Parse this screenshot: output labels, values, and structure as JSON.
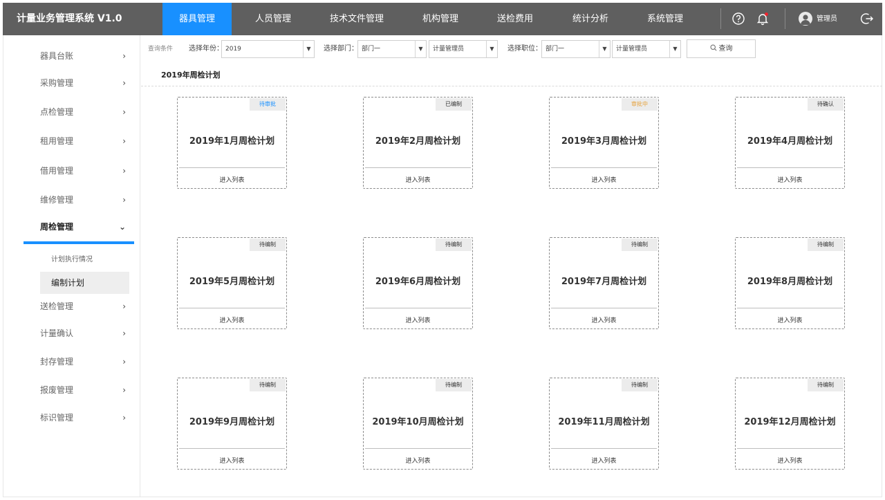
{
  "app": {
    "title": "计量业务管理系统 V1.0"
  },
  "nav": [
    {
      "label": "器具管理",
      "active": true
    },
    {
      "label": "人员管理"
    },
    {
      "label": "技术文件管理"
    },
    {
      "label": "机构管理"
    },
    {
      "label": "送检费用"
    },
    {
      "label": "统计分析"
    },
    {
      "label": "系统管理"
    }
  ],
  "user": {
    "name": "管理员"
  },
  "icons": {
    "help": "help-circle-icon",
    "bell": "bell-icon",
    "logout": "logout-icon",
    "avatar": "user-avatar-icon"
  },
  "colors": {
    "accent": "#1890ff",
    "topbar": "#5f5f5f",
    "badge_blue": "#1890ff",
    "badge_orange": "#e6a23c"
  },
  "sidebar": {
    "items": [
      {
        "label": "器具台账"
      },
      {
        "label": "采购管理"
      },
      {
        "label": "点检管理"
      },
      {
        "label": "租用管理"
      },
      {
        "label": "借用管理"
      },
      {
        "label": "维修管理"
      },
      {
        "label": "周检管理",
        "open": true
      },
      {
        "label": "送检管理"
      },
      {
        "label": "计量确认"
      },
      {
        "label": "封存管理"
      },
      {
        "label": "报废管理"
      },
      {
        "label": "标识管理"
      }
    ],
    "subitems": [
      {
        "label": "计划执行情况"
      },
      {
        "label": "编制计划",
        "active": true
      }
    ]
  },
  "filter": {
    "label": "查询条件",
    "year_label": "选择年份：",
    "year_value": "2019",
    "dept_label": "选择部门：",
    "dept_value": "部门一",
    "dept_role_value": "计量管理员",
    "post_label": "选择职位：",
    "post_value": "部门一",
    "post_role_value": "计量管理员",
    "search_label": "查询"
  },
  "section": {
    "title": "2019年周检计划"
  },
  "cards": [
    {
      "title": "2019年1月周检计划",
      "status": "待审批",
      "link": "进入列表"
    },
    {
      "title": "2019年2月周检计划",
      "status": "已编制",
      "link": "进入列表"
    },
    {
      "title": "2019年3月周检计划",
      "status": "审批中",
      "link": "进入列表"
    },
    {
      "title": "2019年4月周检计划",
      "status": "待确认",
      "link": "进入列表"
    },
    {
      "title": "2019年5月周检计划",
      "status": "待编制",
      "link": "进入列表"
    },
    {
      "title": "2019年6月周检计划",
      "status": "待编制",
      "link": "进入列表"
    },
    {
      "title": "2019年7月周检计划",
      "status": "待编制",
      "link": "进入列表"
    },
    {
      "title": "2019年8月周检计划",
      "status": "待编制",
      "link": "进入列表"
    },
    {
      "title": "2019年9月周检计划",
      "status": "待编制",
      "link": "进入列表"
    },
    {
      "title": "2019年10月周检计划",
      "status": "待编制",
      "link": "进入列表"
    },
    {
      "title": "2019年11月周检计划",
      "status": "待编制",
      "link": "进入列表"
    },
    {
      "title": "2019年12月周检计划",
      "status": "待编制",
      "link": "进入列表"
    }
  ]
}
